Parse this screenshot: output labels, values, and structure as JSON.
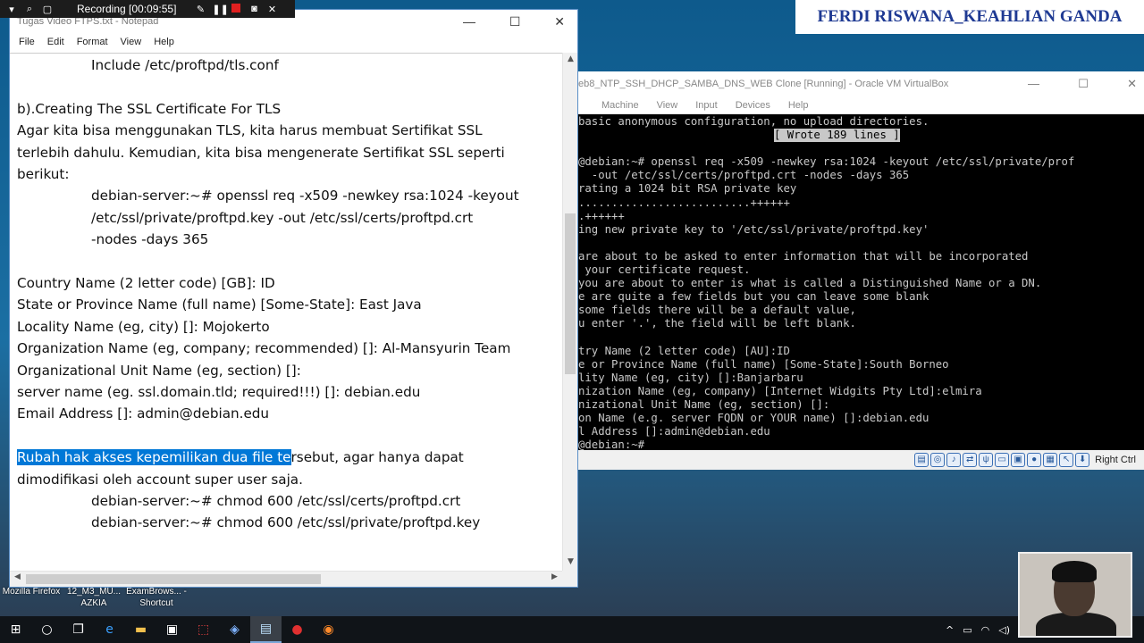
{
  "recording": {
    "label": "Recording [00:09:55]"
  },
  "banner": {
    "text": "FERDI RISWANA_KEAHLIAN GANDA"
  },
  "notepad": {
    "title": "Tugas Video FTPS.txt - Notepad",
    "menu": [
      "File",
      "Edit",
      "Format",
      "View",
      "Help"
    ],
    "selected_text": "Rubah hak akses kepemilikan dua file te",
    "selected_rest": "rsebut, agar hanya dapat",
    "lines": [
      {
        "text": "Include /etc/proftpd/tls.conf",
        "indent": true
      },
      {
        "text": "",
        "indent": false
      },
      {
        "text": "b).Creating The SSL Certificate For TLS",
        "indent": false
      },
      {
        "text": "Agar kita bisa menggunakan TLS, kita harus membuat Sertifikat SSL",
        "indent": false
      },
      {
        "text": "terlebih dahulu. Kemudian, kita bisa mengenerate Sertifikat SSL seperti",
        "indent": false
      },
      {
        "text": "berikut:",
        "indent": false
      },
      {
        "text": "debian-server:~# openssl req -x509 -newkey rsa:1024 -keyout",
        "indent": true
      },
      {
        "text": "/etc/ssl/private/proftpd.key -out /etc/ssl/certs/proftpd.crt",
        "indent": true
      },
      {
        "text": "-nodes -days 365",
        "indent": true
      },
      {
        "text": "",
        "indent": false
      },
      {
        "text": "Country Name (2 letter code) [GB]: ID",
        "indent": false
      },
      {
        "text": "State or Province Name (full name) [Some-State]: East Java",
        "indent": false
      },
      {
        "text": "Locality Name (eg, city) []: Mojokerto",
        "indent": false
      },
      {
        "text": "Organization Name (eg, company; recommended) []: Al-Mansyurin Team",
        "indent": false
      },
      {
        "text": "Organizational Unit Name (eg, section) []:",
        "indent": false
      },
      {
        "text": "server name (eg. ssl.domain.tld; required!!!) []: debian.edu",
        "indent": false
      },
      {
        "text": "Email Address []: admin@debian.edu",
        "indent": false
      },
      {
        "text": "",
        "indent": false
      },
      {
        "text": "__SELECTED__",
        "indent": false
      },
      {
        "text": "dimodifikasi oleh account super user saja.",
        "indent": false
      },
      {
        "text": "debian-server:~# chmod 600 /etc/ssl/certs/proftpd.crt",
        "indent": true
      },
      {
        "text": "debian-server:~# chmod 600 /etc/ssl/private/proftpd.key",
        "indent": true
      }
    ]
  },
  "vbox": {
    "title": "eb8_NTP_SSH_DHCP_SAMBA_DNS_WEB Clone [Running] - Oracle VM VirtualBox",
    "menu": [
      "Machine",
      "View",
      "Input",
      "Devices",
      "Help"
    ],
    "host_key": "Right Ctrl",
    "terminal_lines": [
      "basic anonymous configuration, no upload directories.",
      "__WROTE__",
      "",
      "@debian:~# openssl req -x509 -newkey rsa:1024 -keyout /etc/ssl/private/prof",
      "  -out /etc/ssl/certs/proftpd.crt -nodes -days 365",
      "rating a 1024 bit RSA private key",
      "..........................++++++",
      ".++++++",
      "ing new private key to '/etc/ssl/private/proftpd.key'",
      "",
      "are about to be asked to enter information that will be incorporated",
      " your certificate request.",
      "you are about to enter is what is called a Distinguished Name or a DN.",
      "e are quite a few fields but you can leave some blank",
      "some fields there will be a default value,",
      "u enter '.', the field will be left blank.",
      "",
      "try Name (2 letter code) [AU]:ID",
      "e or Province Name (full name) [Some-State]:South Borneo",
      "lity Name (eg, city) []:Banjarbaru",
      "nization Name (eg, company) [Internet Widgits Pty Ltd]:elmira",
      "nizational Unit Name (eg, section) []:",
      "on Name (e.g. server FQDN or YOUR name) []:debian.edu",
      "l Address []:admin@debian.edu",
      "@debian:~# _"
    ],
    "wrote_text": "[ Wrote 189 lines ]"
  },
  "desktop_icons": [
    {
      "label": "Mozilla Firefox"
    },
    {
      "label": "12_M3_MU... AZKIA"
    },
    {
      "label": "ExamBrows... - Shortcut"
    }
  ]
}
